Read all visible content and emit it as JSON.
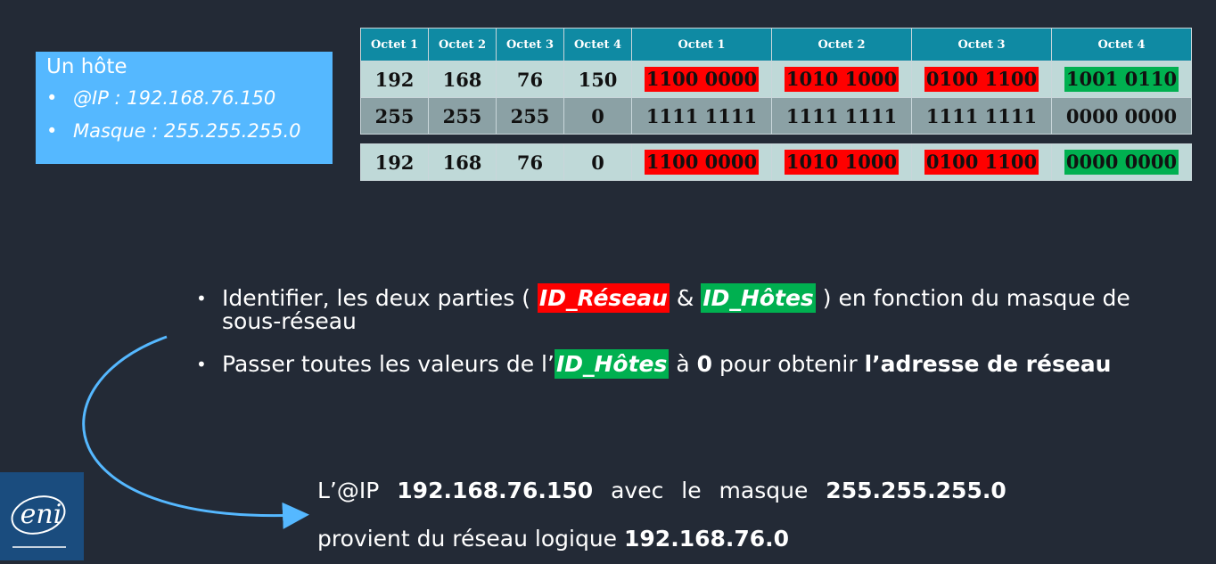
{
  "host": {
    "title": "Un hôte",
    "ip": "@IP : 192.168.76.150",
    "mask": "Masque : 255.255.255.0"
  },
  "table": {
    "headers": [
      "Octet 1",
      "Octet 2",
      "Octet 3",
      "Octet 4",
      "Octet 1",
      "Octet 2",
      "Octet 3",
      "Octet 4"
    ],
    "ip_row": [
      "192",
      "168",
      "76",
      "150",
      "1100 0000",
      "1010 1000",
      "0100 1100",
      "1001 0110"
    ],
    "mask_row": [
      "255",
      "255",
      "255",
      "0",
      "1111 1111",
      "1111 1111",
      "1111 1111",
      "0000 0000"
    ],
    "net_row": [
      "192",
      "168",
      "76",
      "0",
      "1100 0000",
      "1010 1000",
      "0100 1100",
      "0000 0000"
    ]
  },
  "bullets": {
    "b1_pre": "Identifier, les deux parties ( ",
    "b1_reseau": "ID_Réseau",
    "b1_mid": " & ",
    "b1_hotes": "ID_Hôtes",
    "b1_post": " ) en fonction du masque de sous-réseau",
    "b2_pre": "Passer toutes les valeurs de l’",
    "b2_hotes": "ID_Hôtes",
    "b2_mid": " à ",
    "b2_zero": "0",
    "b2_mid2": " pour obtenir ",
    "b2_bold": "l’adresse de réseau"
  },
  "result": {
    "l1_a": "L’@IP",
    "l1_ip": "192.168.76.150",
    "l1_b": "avec le masque",
    "l1_mask": "255.255.255.0",
    "l2_a": "provient du réseau logique",
    "l2_net": "192.168.76.0"
  },
  "logo": {
    "text": "eni"
  },
  "colors": {
    "red": "#ff0000",
    "green": "#00b050",
    "header": "#0f8aa3",
    "background": "#232a36"
  }
}
